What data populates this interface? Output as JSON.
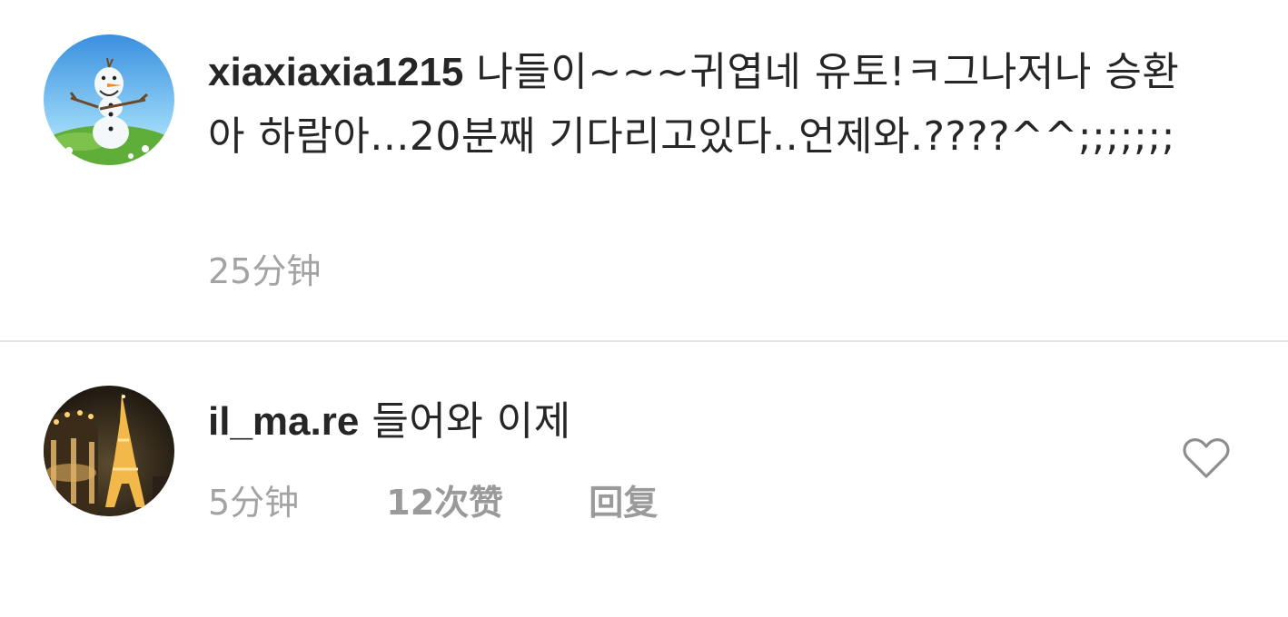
{
  "comments": [
    {
      "username": "xiaxiaxia1215",
      "text": "나들이~~~귀엽네 유토!ㅋ그나저나 승환아 하람아...20분째 기다리고있다..언제와.????^^;;;;;;;",
      "time": "25分钟",
      "avatar_icon": "snowman-avatar"
    },
    {
      "username": "il_ma.re",
      "text": "들어와 이제",
      "time": "5分钟",
      "likes": "12次赞",
      "reply": "回复",
      "avatar_icon": "eiffel-tower-avatar",
      "like_icon": "heart-icon"
    }
  ],
  "colors": {
    "text": "#262626",
    "meta": "#a3a3a3",
    "divider": "#e4e4e4",
    "heart_outline": "#8e8e8e"
  }
}
